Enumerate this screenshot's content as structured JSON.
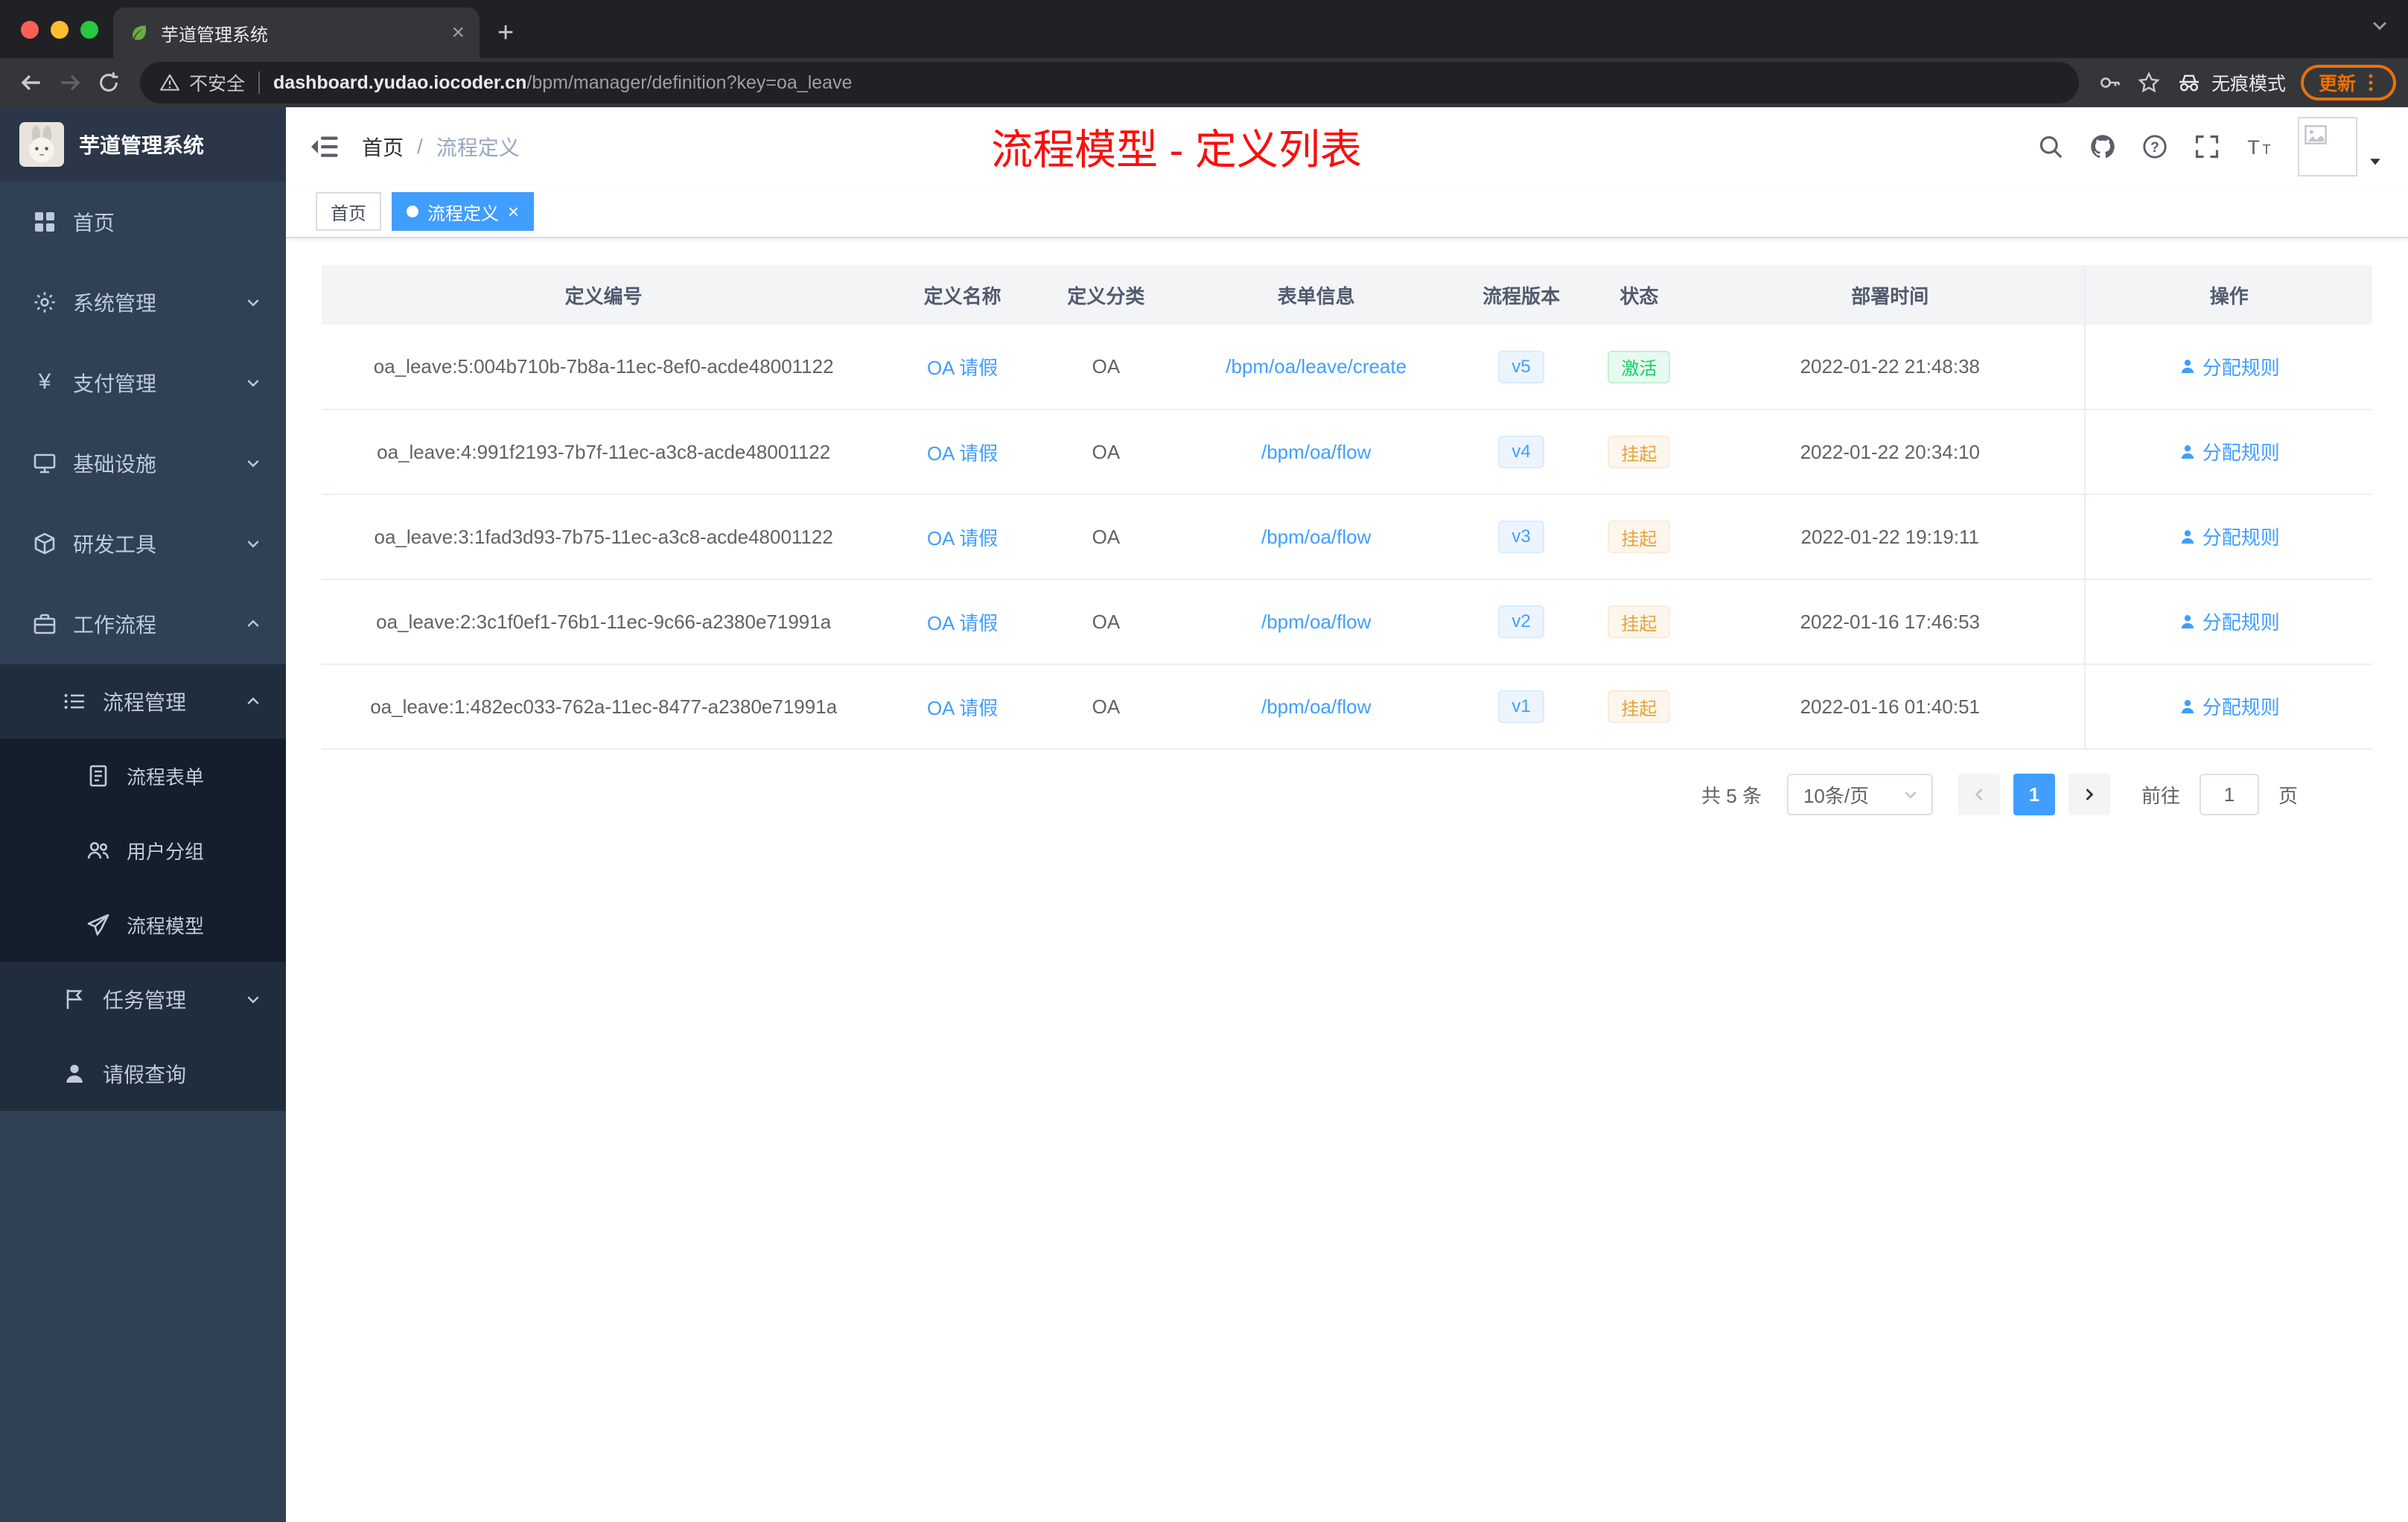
{
  "colors": {
    "accent": "#409eff",
    "success": "#13ce66",
    "warning": "#e6a23c",
    "annotation_red": "#fd0d0d",
    "update_orange": "#e8710a",
    "sidebar_bg": "#304156"
  },
  "icons": [
    "leaf-favicon",
    "dashboard-icon",
    "gear-icon",
    "yen-icon",
    "monitor-icon",
    "cube-icon",
    "briefcase-icon",
    "list-icon",
    "document-icon",
    "users-icon",
    "paper-plane-icon",
    "flag-icon",
    "user-icon",
    "search-icon",
    "github-icon",
    "help-icon",
    "fullscreen-icon",
    "font-size-icon",
    "broken-image-icon",
    "incognito-icon",
    "key-icon",
    "star-icon"
  ],
  "browser": {
    "tab_title": "芋道管理系统",
    "security_label": "不安全",
    "url_host": "dashboard.yudao.iocoder.cn",
    "url_path": "/bpm/manager/definition?key=oa_leave",
    "incognito_label": "无痕模式",
    "update_label": "更新"
  },
  "sidebar": {
    "logo_title": "芋道管理系统",
    "items": [
      {
        "label": "首页"
      },
      {
        "label": "系统管理"
      },
      {
        "label": "支付管理"
      },
      {
        "label": "基础设施"
      },
      {
        "label": "研发工具"
      },
      {
        "label": "工作流程"
      },
      {
        "label": "流程管理"
      },
      {
        "label": "流程表单"
      },
      {
        "label": "用户分组"
      },
      {
        "label": "流程模型"
      },
      {
        "label": "任务管理"
      },
      {
        "label": "请假查询"
      }
    ]
  },
  "navbar": {
    "breadcrumb": [
      "首页",
      "流程定义"
    ],
    "annotation": "流程模型 - 定义列表"
  },
  "tags": [
    {
      "label": "首页"
    },
    {
      "label": "流程定义"
    }
  ],
  "table": {
    "columns": [
      "定义编号",
      "定义名称",
      "定义分类",
      "表单信息",
      "流程版本",
      "状态",
      "部署时间",
      "操作"
    ],
    "rows": [
      {
        "id": "oa_leave:5:004b710b-7b8a-11ec-8ef0-acde48001122",
        "name": "OA 请假",
        "category": "OA",
        "form": "/bpm/oa/leave/create",
        "version": "v5",
        "status": "激活",
        "status_type": "success",
        "time": "2022-01-22 21:48:38",
        "action": "分配规则"
      },
      {
        "id": "oa_leave:4:991f2193-7b7f-11ec-a3c8-acde48001122",
        "name": "OA 请假",
        "category": "OA",
        "form": "/bpm/oa/flow",
        "version": "v4",
        "status": "挂起",
        "status_type": "warning",
        "time": "2022-01-22 20:34:10",
        "action": "分配规则"
      },
      {
        "id": "oa_leave:3:1fad3d93-7b75-11ec-a3c8-acde48001122",
        "name": "OA 请假",
        "category": "OA",
        "form": "/bpm/oa/flow",
        "version": "v3",
        "status": "挂起",
        "status_type": "warning",
        "time": "2022-01-22 19:19:11",
        "action": "分配规则"
      },
      {
        "id": "oa_leave:2:3c1f0ef1-76b1-11ec-9c66-a2380e71991a",
        "name": "OA 请假",
        "category": "OA",
        "form": "/bpm/oa/flow",
        "version": "v2",
        "status": "挂起",
        "status_type": "warning",
        "time": "2022-01-16 17:46:53",
        "action": "分配规则"
      },
      {
        "id": "oa_leave:1:482ec033-762a-11ec-8477-a2380e71991a",
        "name": "OA 请假",
        "category": "OA",
        "form": "/bpm/oa/flow",
        "version": "v1",
        "status": "挂起",
        "status_type": "warning",
        "time": "2022-01-16 01:40:51",
        "action": "分配规则"
      }
    ]
  },
  "pagination": {
    "total": "共 5 条",
    "page_size": "10条/页",
    "page": "1",
    "goto_label": "前往",
    "goto_value": "1",
    "unit_label": "页"
  }
}
